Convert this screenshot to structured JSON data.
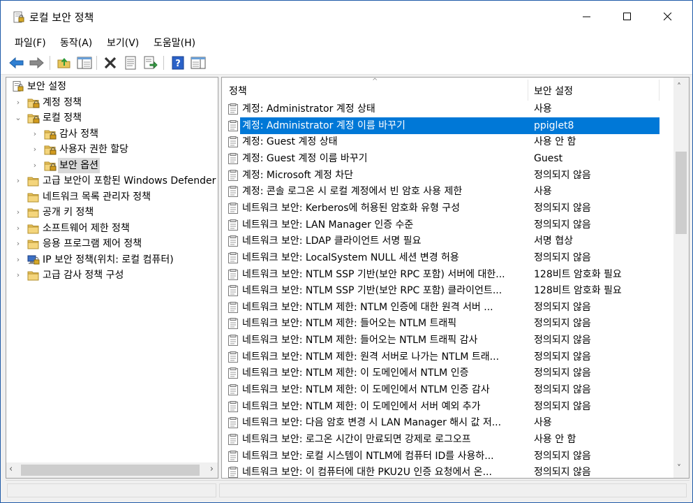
{
  "window": {
    "title": "로컬 보안 정책",
    "controls": {
      "minimize": "—",
      "maximize": "☐",
      "close": "✕"
    }
  },
  "menu": {
    "file": "파일(F)",
    "action": "동작(A)",
    "view": "보기(V)",
    "help": "도움말(H)"
  },
  "toolbar": {
    "icons": [
      "back-arrow-icon",
      "forward-arrow-icon",
      "up-folder-icon",
      "show-hide-tree-icon",
      "delete-icon",
      "properties-icon",
      "export-list-icon",
      "help-icon",
      "console-view-icon"
    ]
  },
  "tree": {
    "items": [
      {
        "label": "보안 설정",
        "level": 0,
        "expander": "",
        "icon": "security-settings-icon"
      },
      {
        "label": "계정 정책",
        "level": 1,
        "expander": "›",
        "icon": "locked-folder-icon"
      },
      {
        "label": "로컬 정책",
        "level": 1,
        "expander": "⌄",
        "icon": "locked-folder-icon"
      },
      {
        "label": "감사 정책",
        "level": 2,
        "expander": "›",
        "icon": "locked-folder-icon"
      },
      {
        "label": "사용자 권한 할당",
        "level": 2,
        "expander": "›",
        "icon": "locked-folder-icon"
      },
      {
        "label": "보안 옵션",
        "level": 2,
        "expander": "›",
        "icon": "locked-folder-icon",
        "selected": true
      },
      {
        "label": "고급 보안이 포함된 Windows Defender 방화벽",
        "level": 1,
        "expander": "›",
        "icon": "folder-icon"
      },
      {
        "label": "네트워크 목록 관리자 정책",
        "level": 1,
        "expander": "",
        "icon": "folder-icon"
      },
      {
        "label": "공개 키 정책",
        "level": 1,
        "expander": "›",
        "icon": "folder-icon"
      },
      {
        "label": "소프트웨어 제한 정책",
        "level": 1,
        "expander": "›",
        "icon": "folder-icon"
      },
      {
        "label": "응용 프로그램 제어 정책",
        "level": 1,
        "expander": "›",
        "icon": "folder-icon"
      },
      {
        "label": "IP 보안 정책(위치: 로컬 컴퓨터)",
        "level": 1,
        "expander": "›",
        "icon": "ip-security-icon"
      },
      {
        "label": "고급 감사 정책 구성",
        "level": 1,
        "expander": "›",
        "icon": "folder-icon"
      }
    ],
    "scroll": {
      "left": "‹",
      "right": "›"
    }
  },
  "list": {
    "columns": {
      "policy": "정책",
      "setting": "보안 설정",
      "sort_indicator": "^"
    },
    "rows": [
      {
        "policy": "계정: Administrator 계정 상태",
        "setting": "사용"
      },
      {
        "policy": "계정: Administrator 계정 이름 바꾸기",
        "setting": "ppiglet8",
        "selected": true
      },
      {
        "policy": "계정: Guest 계정 상태",
        "setting": "사용 안 함"
      },
      {
        "policy": "계정: Guest 계정 이름 바꾸기",
        "setting": "Guest"
      },
      {
        "policy": "계정: Microsoft 계정 차단",
        "setting": "정의되지 않음"
      },
      {
        "policy": "계정: 콘솔 로그온 시 로컬 계정에서 빈 암호 사용 제한",
        "setting": "사용"
      },
      {
        "policy": "네트워크 보안: Kerberos에 허용된 암호화 유형 구성",
        "setting": "정의되지 않음"
      },
      {
        "policy": "네트워크 보안: LAN Manager 인증 수준",
        "setting": "정의되지 않음"
      },
      {
        "policy": "네트워크 보안: LDAP 클라이언트 서명 필요",
        "setting": "서명 협상"
      },
      {
        "policy": "네트워크 보안: LocalSystem NULL 세션 변경 허용",
        "setting": "정의되지 않음"
      },
      {
        "policy": "네트워크 보안: NTLM SSP 기반(보안 RPC 포함) 서버에 대한...",
        "setting": "128비트 암호화 필요"
      },
      {
        "policy": "네트워크 보안: NTLM SSP 기반(보안 RPC 포함) 클라이언트...",
        "setting": "128비트 암호화 필요"
      },
      {
        "policy": "네트워크 보안: NTLM 제한: NTLM 인증에 대한 원격 서버 ...",
        "setting": "정의되지 않음"
      },
      {
        "policy": "네트워크 보안: NTLM 제한: 들어오는 NTLM 트래픽",
        "setting": "정의되지 않음"
      },
      {
        "policy": "네트워크 보안: NTLM 제한: 들어오는 NTLM 트래픽 감사",
        "setting": "정의되지 않음"
      },
      {
        "policy": "네트워크 보안: NTLM 제한: 원격 서버로 나가는 NTLM 트래...",
        "setting": "정의되지 않음"
      },
      {
        "policy": "네트워크 보안: NTLM 제한: 이 도메인에서 NTLM 인증",
        "setting": "정의되지 않음"
      },
      {
        "policy": "네트워크 보안: NTLM 제한: 이 도메인에서 NTLM 인증 감사",
        "setting": "정의되지 않음"
      },
      {
        "policy": "네트워크 보안: NTLM 제한: 이 도메인에서 서버 예외 추가",
        "setting": "정의되지 않음"
      },
      {
        "policy": "네트워크 보안: 다음 암호 변경 시 LAN Manager 해시 값 저...",
        "setting": "사용"
      },
      {
        "policy": "네트워크 보안: 로그온 시간이 만료되면 강제로 로그오프",
        "setting": "사용 안 함"
      },
      {
        "policy": "네트워크 보안: 로컬 시스템이 NTLM에 컴퓨터 ID를 사용하...",
        "setting": "정의되지 않음"
      },
      {
        "policy": "네트워크 보안: 이 컴퓨터에 대한 PKU2U 인증 요청에서 온...",
        "setting": "정의되지 않음"
      }
    ],
    "scroll": {
      "up": "˄",
      "down": "˅"
    }
  },
  "colors": {
    "selection": "#0078d7",
    "window_border": "#1f5aa8",
    "tree_selection": "#d9d9d9"
  }
}
